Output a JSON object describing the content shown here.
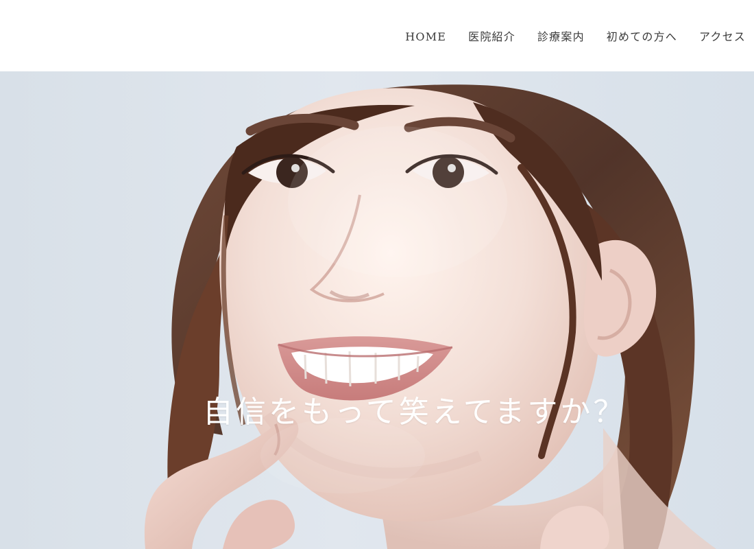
{
  "header": {
    "nav": [
      {
        "label": "HOME"
      },
      {
        "label": "医院紹介"
      },
      {
        "label": "診療案内"
      },
      {
        "label": "初めての方へ"
      },
      {
        "label": "アクセス"
      }
    ]
  },
  "hero": {
    "tagline": "自信をもって笑えてますか？"
  }
}
